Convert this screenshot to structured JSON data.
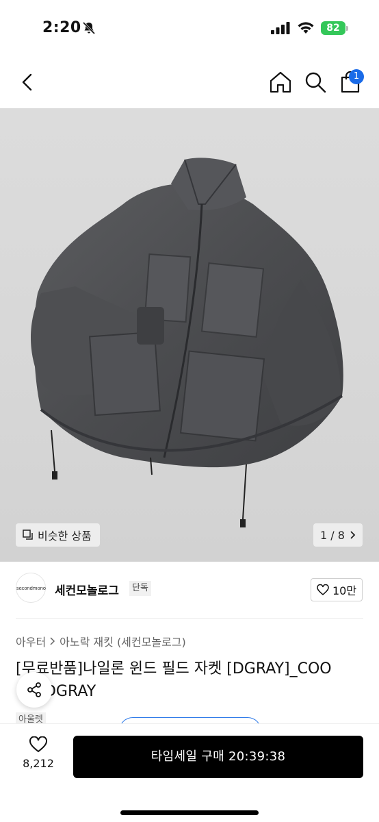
{
  "status_bar": {
    "time": "2:20",
    "battery": "82"
  },
  "nav": {
    "cart_count": "1"
  },
  "gallery": {
    "similar_label": "비슷한 상품",
    "page": "1 / 8"
  },
  "brand": {
    "logo_text": "secondmono",
    "name": "세컨모놀로그",
    "tag": "단독",
    "likes": "10만"
  },
  "breadcrumb": {
    "level1": "아우터",
    "level2": "아노락 재킷 (세컨모놀로그)"
  },
  "product": {
    "title": "[무료반품]나일론 윈드 필드 자켓 [DGRAY]_COO 026DGRAY",
    "outlet_tag": "아울렛"
  },
  "bottom_bar": {
    "wish_count": "8,212",
    "buy_label": "타임세일 구매 20:39:38"
  },
  "colors": {
    "accent": "#1a6be8",
    "buy": "#000000",
    "battery": "#34c759"
  }
}
